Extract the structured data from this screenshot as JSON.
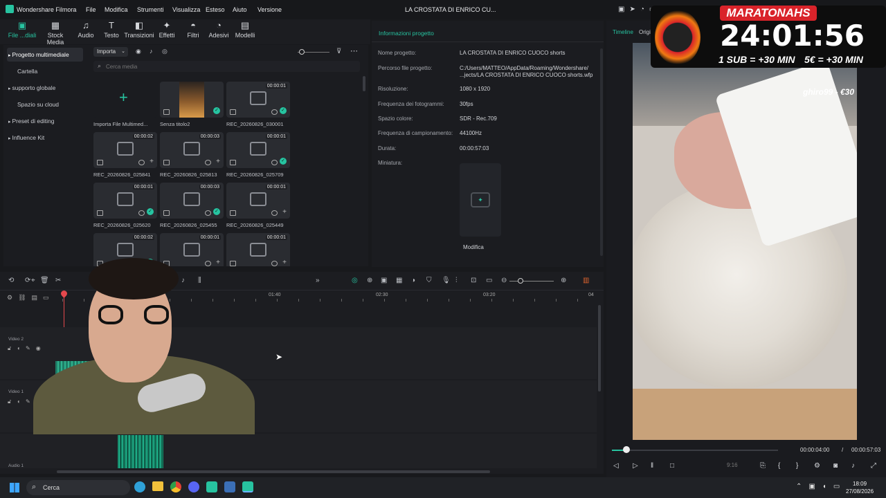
{
  "app": {
    "name": "Wondershare Filmora",
    "window_title": "LA CROSTATA DI ENRICO CU..."
  },
  "menu": [
    "File",
    "Modifica",
    "Strumenti",
    "Visualizza",
    "Esteso",
    "Aiuto",
    "Versione"
  ],
  "toolbar": [
    {
      "label": "File ...diali",
      "icon": "folder-icon"
    },
    {
      "label": "Stock Media",
      "icon": "stock-icon"
    },
    {
      "label": "Audio",
      "icon": "music-note-icon"
    },
    {
      "label": "Testo",
      "icon": "text-icon"
    },
    {
      "label": "Transizioni",
      "icon": "transition-icon"
    },
    {
      "label": "Effetti",
      "icon": "effects-icon"
    },
    {
      "label": "Filtri",
      "icon": "filter-icon"
    },
    {
      "label": "Adesivi",
      "icon": "sticker-icon"
    },
    {
      "label": "Modelli",
      "icon": "template-icon"
    }
  ],
  "sidebar": [
    {
      "label": "Progetto multimediale",
      "selected": true,
      "arrow": true
    },
    {
      "label": "Cartella",
      "selected": false,
      "arrow": false
    },
    {
      "label": "supporto globale",
      "selected": false,
      "arrow": true
    },
    {
      "label": "Spazio su cloud",
      "selected": false,
      "arrow": false
    },
    {
      "label": "Preset di editing",
      "selected": false,
      "arrow": true
    },
    {
      "label": "Influence Kit",
      "selected": false,
      "arrow": true
    }
  ],
  "media": {
    "import_label": "Importa",
    "search_placeholder": "Cerca media",
    "items": [
      {
        "name": "Importa File Multimed...",
        "type": "import"
      },
      {
        "name": "Senza titolo2",
        "type": "thumb",
        "check": true
      },
      {
        "name": "REC_20260826_030001",
        "dur": "00:00:01",
        "check": true
      },
      {
        "name": "REC_20260826_025841",
        "dur": "00:00:02",
        "check": false
      },
      {
        "name": "REC_20260826_025813",
        "dur": "00:00:03",
        "check": false
      },
      {
        "name": "REC_20260826_025709",
        "dur": "00:00:01",
        "check": true
      },
      {
        "name": "REC_20260826_025620",
        "dur": "00:00:01",
        "check": true
      },
      {
        "name": "REC_20260826_025455",
        "dur": "00:00:03",
        "check": true
      },
      {
        "name": "REC_20260826_025449",
        "dur": "00:00:01",
        "check": false
      },
      {
        "name": "",
        "dur": "00:00:02",
        "check": true
      },
      {
        "name": "",
        "dur": "00:00:01",
        "check": false
      },
      {
        "name": "",
        "dur": "00:00:01",
        "check": false
      }
    ]
  },
  "info": {
    "title": "Informazioni progetto",
    "rows": [
      {
        "label": "Nome progetto:",
        "value": "LA CROSTATA DI ENRICO CUOCO shorts"
      },
      {
        "label": "Percorso file progetto:",
        "value": "C:/Users/MATTEO/AppData/Roaming/Wondershare/\n...jects/LA CROSTATA DI ENRICO CUOCO shorts.wfp"
      },
      {
        "label": "Risoluzione:",
        "value": "1080 x 1920"
      },
      {
        "label": "Frequenza dei fotogrammi:",
        "value": "30fps"
      },
      {
        "label": "Spazio colore:",
        "value": "SDR - Rec.709"
      },
      {
        "label": "Frequenza di campionamento:",
        "value": "44100Hz"
      },
      {
        "label": "Durata:",
        "value": "00:00:57:03"
      },
      {
        "label": "Miniatura:",
        "value": ""
      }
    ],
    "edit_label": "Modifica"
  },
  "player": {
    "tabs": [
      "Timeline",
      "Origin"
    ],
    "current_time": "00:00:04:00",
    "separator": "/",
    "total_time": "00:00:57:03",
    "ratio": "9:16",
    "progress": 0.04
  },
  "overlay": {
    "title": "MARATONAHS",
    "timer": "24:01:56",
    "rule1": "1 SUB = +30 MIN",
    "rule2": "5€ = +30 MIN",
    "donation": "ghiro99 - €30"
  },
  "timeline": {
    "ruler": [
      "01:40",
      "02:30",
      "03:20",
      "04"
    ],
    "tracks": [
      "Video 2",
      "Video 1",
      "Audio 1"
    ]
  },
  "taskbar": {
    "search": "Cerca",
    "time": "18:09",
    "date": "27/08/2026"
  },
  "colors": {
    "accent": "#26c4a1",
    "playhead": "#e5484d",
    "overlay_red": "#d9232a"
  }
}
